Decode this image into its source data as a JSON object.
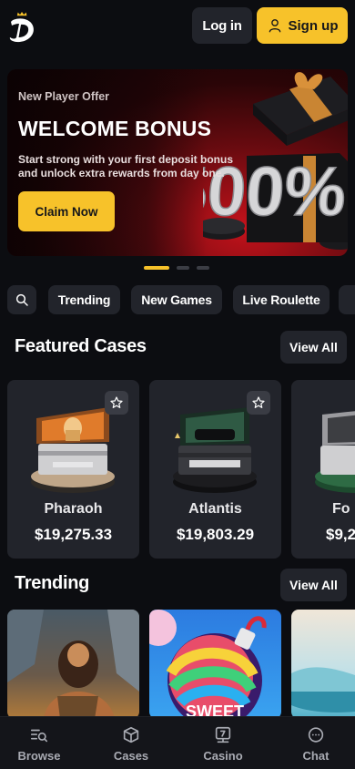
{
  "header": {
    "login_label": "Log in",
    "signup_label": "Sign up"
  },
  "banner": {
    "eyebrow": "New Player Offer",
    "title": "WELCOME BONUS",
    "description": "Start strong with your first deposit bonus and unlock extra rewards from day one.",
    "cta_label": "Claim Now",
    "graphic_text": "500%"
  },
  "carousel": {
    "count": 3,
    "active_index": 0
  },
  "chips": [
    "Trending",
    "New Games",
    "Live Roulette"
  ],
  "featured": {
    "title": "Featured Cases",
    "view_all_label": "View All",
    "cases": [
      {
        "name": "Pharaoh",
        "price": "$19,275.33"
      },
      {
        "name": "Atlantis",
        "price": "$19,803.29"
      },
      {
        "name": "Fo",
        "price": "$9,2"
      }
    ]
  },
  "trending": {
    "title": "Trending",
    "view_all_label": "View All",
    "games": [
      {
        "icon": "caveman-game-thumbnail"
      },
      {
        "icon": "sweet-bomb-game-thumbnail",
        "caption": "SWEET"
      },
      {
        "icon": "landscape-game-thumbnail"
      }
    ]
  },
  "nav": {
    "items": [
      {
        "label": "Browse",
        "icon": "browse-icon"
      },
      {
        "label": "Cases",
        "icon": "cases-icon"
      },
      {
        "label": "Casino",
        "icon": "casino-icon"
      },
      {
        "label": "Chat",
        "icon": "chat-icon"
      }
    ]
  },
  "colors": {
    "background": "#0c0d11",
    "surface": "#22242b",
    "accent": "#f7c22a",
    "banner_red": "#c4121b"
  }
}
